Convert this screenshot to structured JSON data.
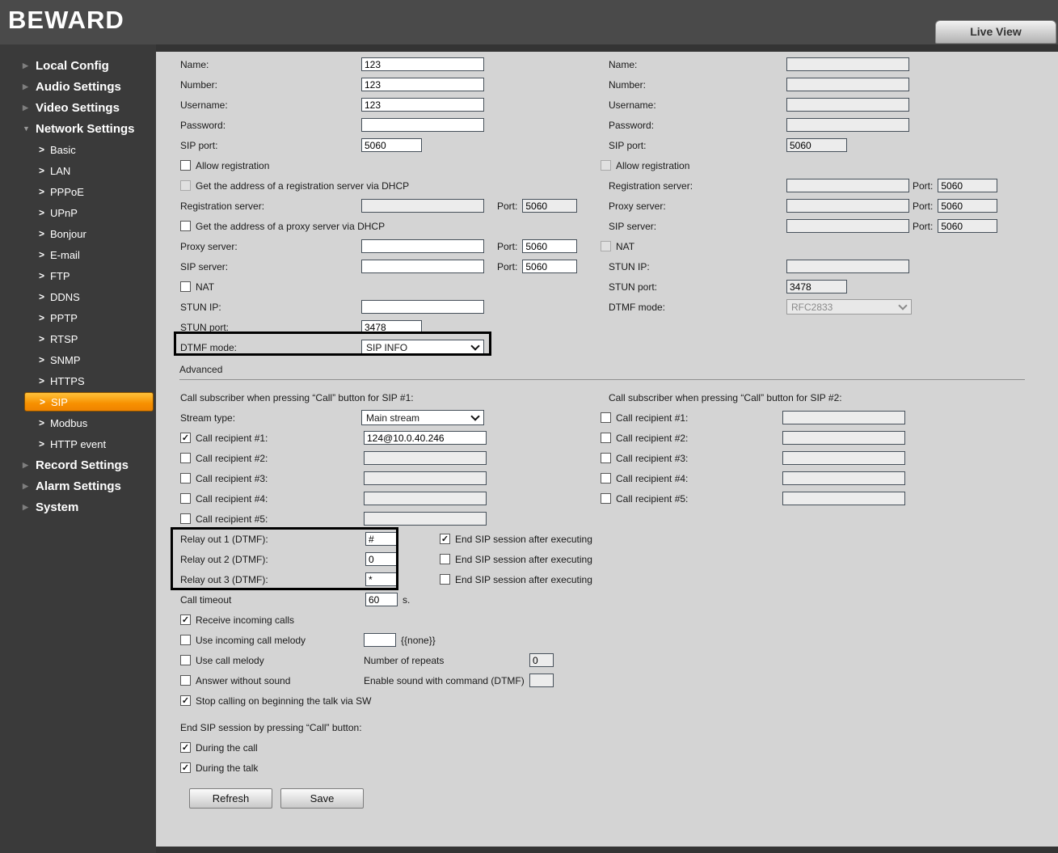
{
  "header": {
    "logo": "BEWARD",
    "live_view": "Live View"
  },
  "sidebar": {
    "local_config": "Local Config",
    "audio_settings": "Audio Settings",
    "video_settings": "Video Settings",
    "network_settings": "Network Settings",
    "record_settings": "Record Settings",
    "alarm_settings": "Alarm Settings",
    "system": "System",
    "net_children": [
      "Basic",
      "LAN",
      "PPPoE",
      "UPnP",
      "Bonjour",
      "E-mail",
      "FTP",
      "DDNS",
      "PPTP",
      "RTSP",
      "SNMP",
      "HTTPS",
      "SIP",
      "Modbus",
      "HTTP event"
    ],
    "active_item": "SIP"
  },
  "labels": {
    "name": "Name:",
    "number": "Number:",
    "username": "Username:",
    "password": "Password:",
    "sip_port": "SIP port:",
    "allow_registration": "Allow registration",
    "reg_dhcp": "Get the address of a registration server via DHCP",
    "proxy_dhcp": "Get the address of a proxy server via DHCP",
    "registration_server": "Registration server:",
    "proxy_server": "Proxy server:",
    "sip_server": "SIP server:",
    "port": "Port:",
    "nat": "NAT",
    "stun_ip": "STUN IP:",
    "stun_port": "STUN port:",
    "dtmf_mode": "DTMF mode:"
  },
  "sip1": {
    "name": "123",
    "number": "123",
    "username": "123",
    "password": "",
    "sip_port": "5060",
    "allow_registration_mark": "",
    "reg_dhcp_mark": "",
    "reg_server": "",
    "reg_port": "5060",
    "proxy_dhcp_mark": "",
    "proxy_server": "",
    "proxy_port": "5060",
    "sip_server": "",
    "sip_server_port": "5060",
    "nat_mark": "",
    "stun_ip": "",
    "stun_port": "3478",
    "dtmf_mode": "SIP INFO"
  },
  "sip2": {
    "name": "",
    "number": "",
    "username": "",
    "password": "",
    "sip_port": "5060",
    "allow_registration_mark": "",
    "reg_server": "",
    "reg_port": "5060",
    "proxy_server": "",
    "proxy_port": "5060",
    "sip_server": "",
    "sip_server_port": "5060",
    "nat_mark": "",
    "stun_ip": "",
    "stun_port": "3478",
    "dtmf_mode": "RFC2833"
  },
  "advanced": {
    "section_title": "Advanced",
    "sip1_header": "Call subscriber when pressing “Call” button for SIP #1:",
    "sip2_header": "Call subscriber when pressing “Call” button for SIP #2:",
    "stream_type_label": "Stream type:",
    "stream_type": "Main stream",
    "recipient_labels": [
      "Call recipient #1:",
      "Call recipient #2:",
      "Call recipient #3:",
      "Call recipient #4:",
      "Call recipient #5:"
    ],
    "sip1_recipients": {
      "r1": "124@10.0.40.246",
      "r2": "",
      "r3": "",
      "r4": "",
      "r5": "",
      "r1_mark": "✓",
      "r2_mark": "",
      "r3_mark": "",
      "r4_mark": "",
      "r5_mark": ""
    },
    "sip2_recipients": {
      "r1": "",
      "r2": "",
      "r3": "",
      "r4": "",
      "r5": "",
      "marks": ""
    },
    "relay_labels": [
      "Relay out 1 (DTMF):",
      "Relay out 2 (DTMF):",
      "Relay out 3 (DTMF):"
    ],
    "relay_values": [
      "#",
      "0",
      "*"
    ],
    "end_sip_label": "End SIP session after executing",
    "end_sip_marks": [
      "✓",
      "",
      ""
    ],
    "call_timeout_label": "Call timeout",
    "call_timeout": "60",
    "seconds_suffix": "s.",
    "receive_incoming_label": "Receive incoming calls",
    "receive_incoming_mark": "✓",
    "incoming_melody_label": "Use incoming call melody",
    "incoming_melody_value": "",
    "none_text": "{{none}}",
    "call_melody_label": "Use call melody",
    "call_melody_mark": "",
    "repeats_label": "Number of repeats",
    "repeats_value": "0",
    "answer_without_sound_label": "Answer without sound",
    "answer_without_sound_mark": "",
    "enable_sound_label": "Enable sound with command (DTMF)",
    "enable_sound_value": "",
    "stop_calling_label": "Stop calling on beginning the talk via SW",
    "stop_calling_mark": "✓",
    "end_session_header": "End SIP session by pressing “Call” button:",
    "during_call_label": "During the call",
    "during_call_mark": "✓",
    "during_talk_label": "During the talk",
    "during_talk_mark": "✓"
  },
  "buttons": {
    "refresh": "Refresh",
    "save": "Save"
  },
  "colors": {
    "active_item": "#f79000",
    "header_bg": "#4a4a4a",
    "sidebar_bg": "#3a3a3a",
    "content_bg": "#d4d4d4",
    "highlight_border": "#000000"
  }
}
